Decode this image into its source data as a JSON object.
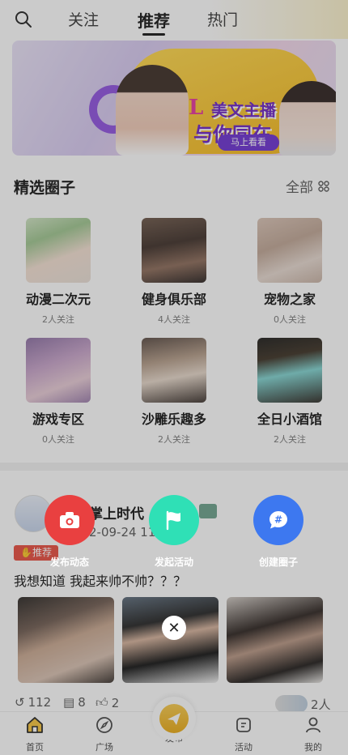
{
  "header": {
    "tabs": [
      {
        "label": "关注"
      },
      {
        "label": "推荐"
      },
      {
        "label": "热门"
      }
    ]
  },
  "banner": {
    "logo_text": "L",
    "headline_line1": "美文主播",
    "headline_line2": "与你同在",
    "cta": "马上看看"
  },
  "circles": {
    "title": "精选圈子",
    "all_label": "全部",
    "items": [
      {
        "name": "动漫二次元",
        "followers": "2人关注"
      },
      {
        "name": "健身俱乐部",
        "followers": "4人关注"
      },
      {
        "name": "宠物之家",
        "followers": "0人关注"
      },
      {
        "name": "游戏专区",
        "followers": "0人关注"
      },
      {
        "name": "沙雕乐趣多",
        "followers": "2人关注"
      },
      {
        "name": "全日小酒馆",
        "followers": "2人关注"
      }
    ]
  },
  "post": {
    "author": "掌上时代",
    "date": "2-09-24 11",
    "tag": "推荐",
    "text": "我想知道 我起来帅不帅？？？",
    "likes": "112",
    "comments": "8",
    "thumbs": "2",
    "viewers": "2人"
  },
  "actions": [
    {
      "label": "发布动态",
      "color": "#e94040"
    },
    {
      "label": "发起活动",
      "color": "#2fe0b6"
    },
    {
      "label": "创建圈子",
      "color": "#3d78f0"
    }
  ],
  "bottom_nav": [
    {
      "label": "首页"
    },
    {
      "label": "广场"
    },
    {
      "label": "发布"
    },
    {
      "label": "活动"
    },
    {
      "label": "我的"
    }
  ]
}
